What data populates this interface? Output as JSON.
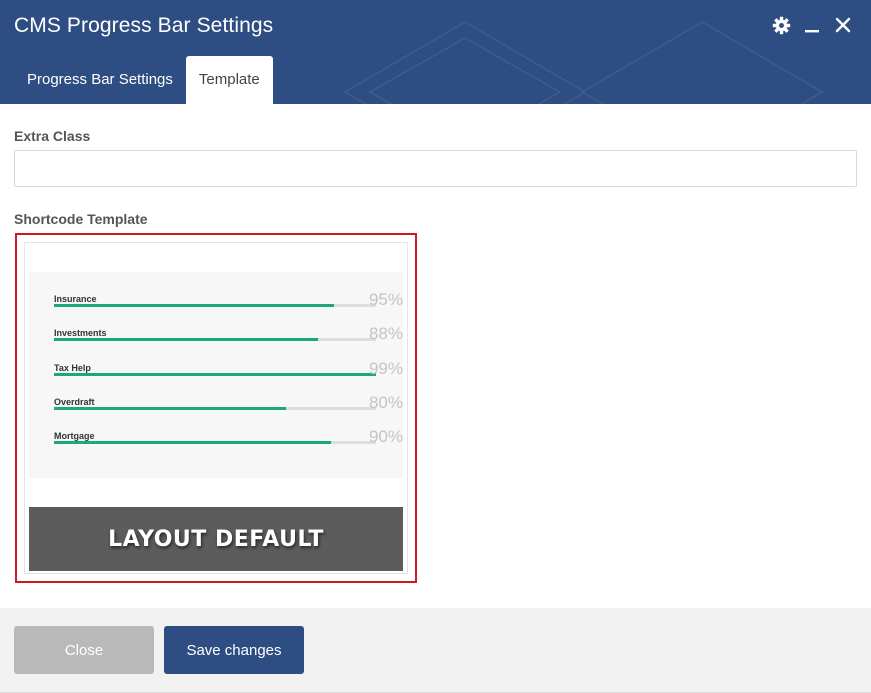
{
  "dialog": {
    "title": "CMS Progress Bar Settings",
    "icons": [
      "gear-icon",
      "minimize-icon",
      "close-icon"
    ]
  },
  "tabs": [
    {
      "label": "Progress Bar Settings",
      "active": false
    },
    {
      "label": "Template",
      "active": true
    }
  ],
  "fields": {
    "extra_class": {
      "label": "Extra Class",
      "value": "",
      "placeholder": ""
    },
    "shortcode_template": {
      "label": "Shortcode Template"
    }
  },
  "template_preview": {
    "items": [
      {
        "label": "Insurance",
        "percent_text": "95%",
        "fill_fraction": 0.87
      },
      {
        "label": "Investments",
        "percent_text": "88%",
        "fill_fraction": 0.82
      },
      {
        "label": "Tax Help",
        "percent_text": "99%",
        "fill_fraction": 1.0
      },
      {
        "label": "Overdraft",
        "percent_text": "80%",
        "fill_fraction": 0.72
      },
      {
        "label": "Mortgage",
        "percent_text": "90%",
        "fill_fraction": 0.86
      }
    ],
    "banner_text": "LAYOUT DEFAULT"
  },
  "footer": {
    "close_label": "Close",
    "save_label": "Save changes"
  },
  "colors": {
    "header": "#2e4d82",
    "progress_fill": "#1aaa72",
    "selection_border": "#d2161c",
    "close_button": "#b9b9b9",
    "save_button": "#2e4d82"
  }
}
